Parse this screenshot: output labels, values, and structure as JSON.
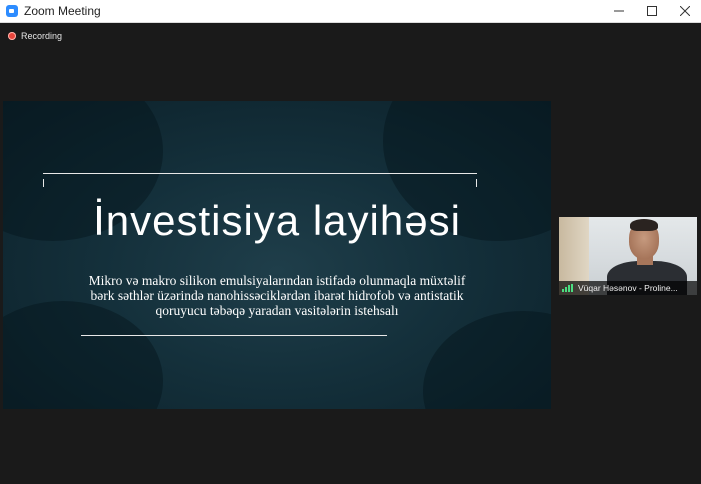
{
  "window": {
    "title": "Zoom Meeting",
    "controls": {
      "minimize": "–",
      "maximize": "□",
      "close": "✕"
    }
  },
  "recording": {
    "label": "Recording",
    "color": "#e8453c"
  },
  "slide": {
    "title": "İnvestisiya layihəsi",
    "subtitle_lines": [
      "Mikro və makro silikon emulsiyalarından istifadə olunmaqla müxtəlif",
      "bərk səthlər üzərində nanohissəciklərdən ibarət hidrofob və antistatik",
      "qoruyucu təbəqə yaradan vasitələrin istehsalı"
    ]
  },
  "participant": {
    "name": "Vüqar Həsənov - Proline...",
    "icon": "signal-strength-icon"
  },
  "colors": {
    "app_accent": "#2d8cff",
    "background": "#1a1a1a",
    "slide_bg": "#14303b",
    "signal": "#4ade80"
  }
}
